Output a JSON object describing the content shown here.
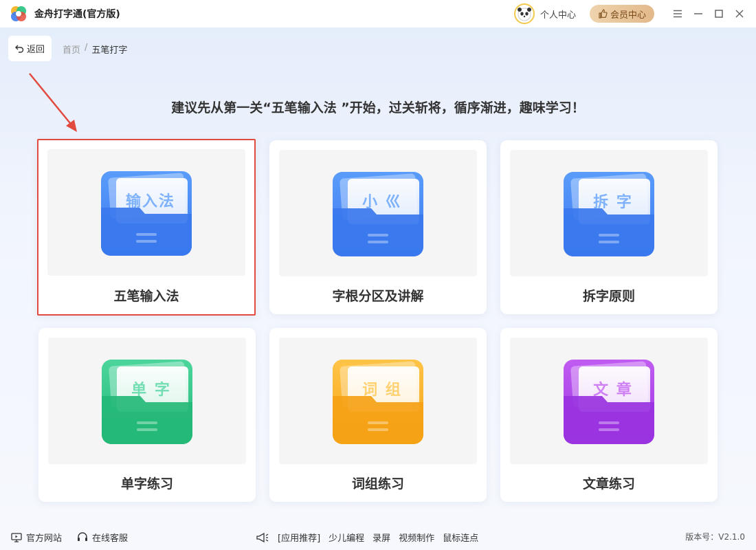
{
  "app": {
    "title": "金舟打字通(官方版)"
  },
  "header": {
    "personal_center": "个人中心",
    "vip_center": "会员中心"
  },
  "nav": {
    "back_label": "返回",
    "breadcrumb": [
      "首页",
      "/",
      "五笔打字"
    ]
  },
  "hint": "建议先从第一关“五笔输入法 ”开始，过关斩将，循序渐进，趣味学习！",
  "cards": [
    {
      "label": "五笔输入法",
      "paper_text": "输入法",
      "theme": "blue",
      "color_top": "#5a9cfb",
      "color_bottom": "#3a78ee",
      "selected": true
    },
    {
      "label": "字根分区及讲解",
      "paper_text": "小 巛",
      "theme": "blue",
      "color_top": "#5a9cfb",
      "color_bottom": "#3a78ee",
      "selected": false
    },
    {
      "label": "拆字原则",
      "paper_text": "拆 字",
      "theme": "blue",
      "color_top": "#5a9cfb",
      "color_bottom": "#3a78ee",
      "selected": false
    },
    {
      "label": "单字练习",
      "paper_text": "单 字",
      "theme": "green",
      "color_top": "#4bd59c",
      "color_bottom": "#25b878",
      "selected": false
    },
    {
      "label": "词组练习",
      "paper_text": "词 组",
      "theme": "orange",
      "color_top": "#ffc447",
      "color_bottom": "#f5a216",
      "selected": false
    },
    {
      "label": "文章练习",
      "paper_text": "文 章",
      "theme": "purple",
      "color_top": "#c15cf2",
      "color_bottom": "#9a33e0",
      "selected": false
    }
  ],
  "footer": {
    "official_site": "官方网站",
    "online_service": "在线客服",
    "app_recommend": "[应用推荐]",
    "links": [
      "少儿编程",
      "录屏",
      "视频制作",
      "鼠标连点"
    ],
    "version": "版本号：V2.1.0"
  },
  "colors": {
    "accent_red": "#e24a3f",
    "vip_gold": "#e2b98a"
  }
}
